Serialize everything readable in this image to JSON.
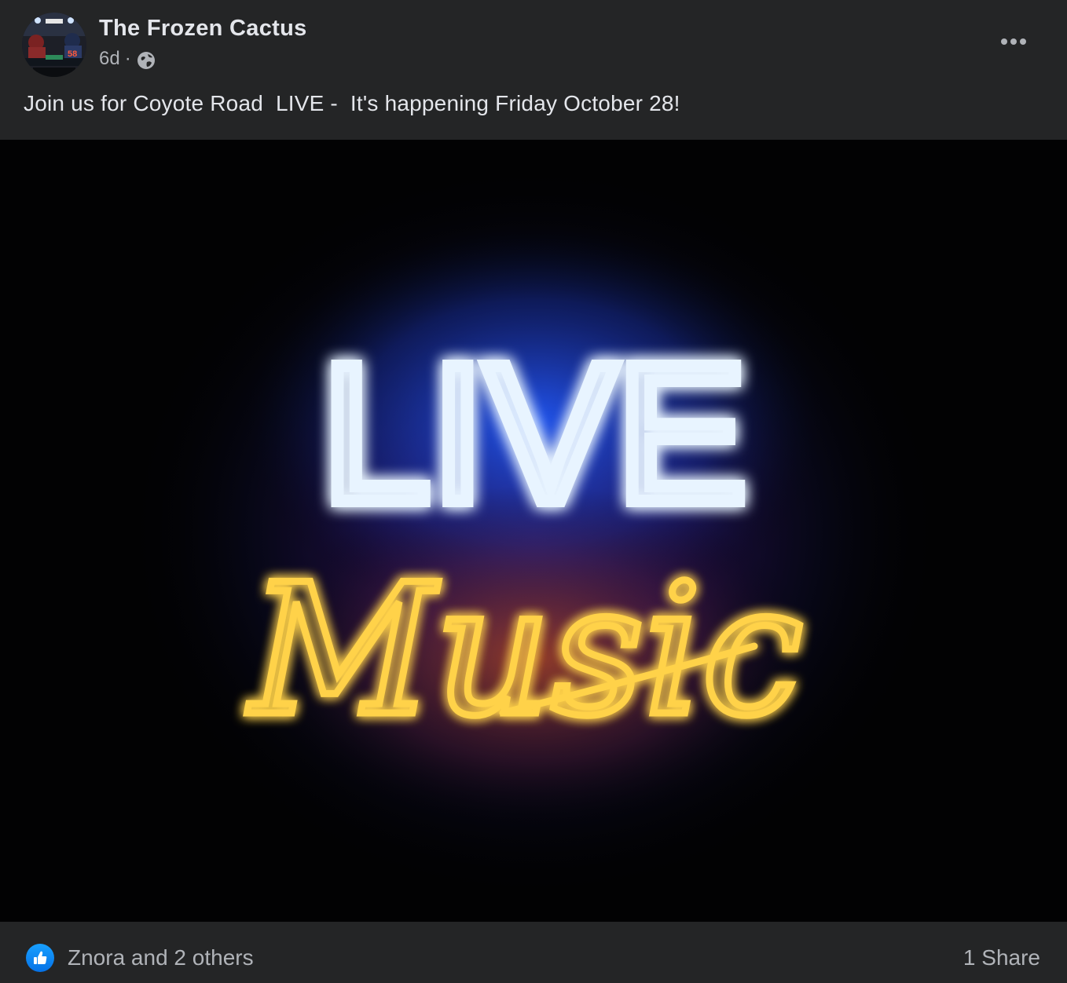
{
  "post": {
    "page_name": "The Frozen Cactus",
    "time_ago": "6d",
    "separator": "·",
    "privacy_icon": "globe-icon",
    "more_icon": "more-options-icon",
    "text": "Join us for Coyote Road  LIVE -  It's happening Friday October 28!"
  },
  "image": {
    "neon_top": "LIVE",
    "neon_bottom": "Music",
    "colors": {
      "live_glow": "#2f7bff",
      "live_core": "#e8f4ff",
      "music_glow": "#ff8a1c",
      "music_core": "#ffd24a",
      "purple_glow": "#6a28c8"
    }
  },
  "footer": {
    "reaction_icon": "like-icon",
    "reactions": "Znora and 2 others",
    "shares": "1 Share"
  },
  "colors": {
    "background": "#242526",
    "primary_text": "#e4e6eb",
    "secondary_text": "#b0b3b8",
    "like_blue": "#0c82f5"
  }
}
